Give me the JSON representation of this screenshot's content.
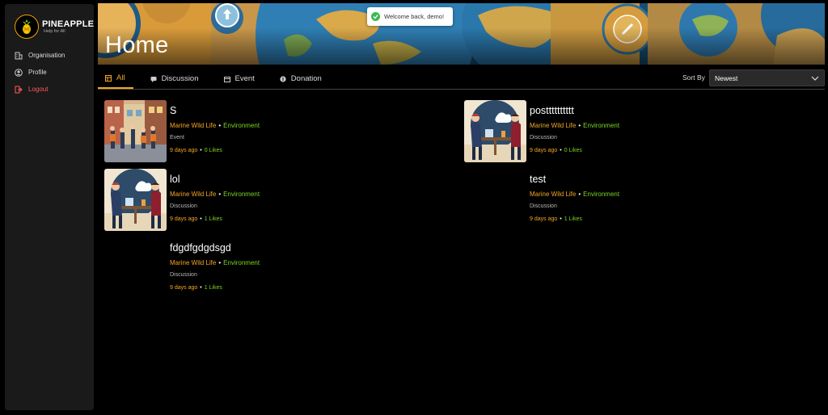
{
  "brand": {
    "name": "PINEAPPLE",
    "tagline": "Help for All"
  },
  "sidebar": {
    "items": [
      {
        "label": "Organisation",
        "icon": "building-icon"
      },
      {
        "label": "Profile",
        "icon": "user-icon"
      },
      {
        "label": "Logout",
        "icon": "logout-icon"
      }
    ]
  },
  "header": {
    "title": "Home"
  },
  "toast": {
    "message": "Welcome back, demo!",
    "icon": "check-circle-icon"
  },
  "tabs": [
    {
      "label": "All",
      "icon": "grid-icon",
      "active": true
    },
    {
      "label": "Discussion",
      "icon": "chat-icon",
      "active": false
    },
    {
      "label": "Event",
      "icon": "calendar-icon",
      "active": false
    },
    {
      "label": "Donation",
      "icon": "dollar-icon",
      "active": false
    }
  ],
  "sort": {
    "label": "Sort By",
    "selected": "Newest"
  },
  "colors": {
    "accent": "#f5a623",
    "green": "#7ed321",
    "logout": "#ff5a5a",
    "sidebar": "#1a1a1a"
  },
  "posts": [
    {
      "title": "S",
      "category": "Marine Wild Life",
      "subcategory": "Environment",
      "type": "Event",
      "age": "9 days ago",
      "likes": "0 Likes",
      "image": "street-scene"
    },
    {
      "title": "postttttttttt",
      "category": "Marine Wild Life",
      "subcategory": "Environment",
      "type": "Discussion",
      "age": "9 days ago",
      "likes": "0 Likes",
      "image": "cafe-talk"
    },
    {
      "title": "lol",
      "category": "Marine Wild Life",
      "subcategory": "Environment",
      "type": "Discussion",
      "age": "9 days ago",
      "likes": "1 Likes",
      "image": "cafe-talk"
    },
    {
      "title": "test",
      "category": "Marine Wild Life",
      "subcategory": "Environment",
      "type": "Discussion",
      "age": "9 days ago",
      "likes": "1 Likes",
      "image": ""
    },
    {
      "title": "fdgdfgdgdsgd",
      "category": "Marine Wild Life",
      "subcategory": "Environment",
      "type": "Discussion",
      "age": "9 days ago",
      "likes": "1 Likes",
      "image": ""
    }
  ]
}
